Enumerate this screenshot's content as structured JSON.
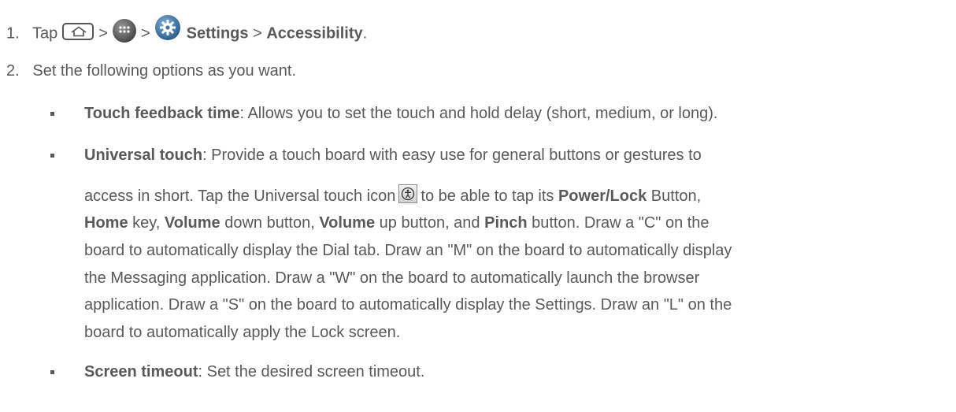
{
  "step1": {
    "number": "1.",
    "tap": "Tap",
    "sep1": ">",
    "sep2": ">",
    "settings": "Settings",
    "sep3": ">",
    "accessibility": "Accessibility",
    "end": "."
  },
  "step2": {
    "number": "2.",
    "text": "Set the following options as you want."
  },
  "bullets": {
    "touch_feedback": {
      "label": "Touch feedback time",
      "text": ": Allows you to set the touch and hold delay (short, medium, or long)."
    },
    "universal_touch": {
      "label": "Universal touch",
      "text1": ": Provide a touch board with easy use for general buttons or gestures to",
      "text2a": "access in short. Tap the Universal touch icon",
      "text2b": "to be able to tap its",
      "power_lock": "Power/Lock",
      "text2c": "Button,",
      "home": "Home",
      "text3a": "key,",
      "volume1": "Volume",
      "text3b": "down button,",
      "volume2": "Volume",
      "text3c": "up button, and",
      "pinch": "Pinch",
      "text3d": "button. Draw a \"C\" on the",
      "line4": "board to automatically display the Dial tab. Draw an \"M\" on the board to automatically display",
      "line5": "the Messaging application. Draw a \"W\" on the board to automatically launch the browser",
      "line6": "application. Draw a \"S\" on the board to automatically display the Settings. Draw an \"L\" on the",
      "line7": "board to automatically apply the Lock screen."
    },
    "screen_timeout": {
      "label": "Screen timeout",
      "text": ": Set the desired screen timeout."
    }
  },
  "icons": {
    "home": "home-key-icon",
    "apps": "apps-icon",
    "settings": "settings-gear-icon",
    "universal_touch": "universal-touch-icon"
  }
}
